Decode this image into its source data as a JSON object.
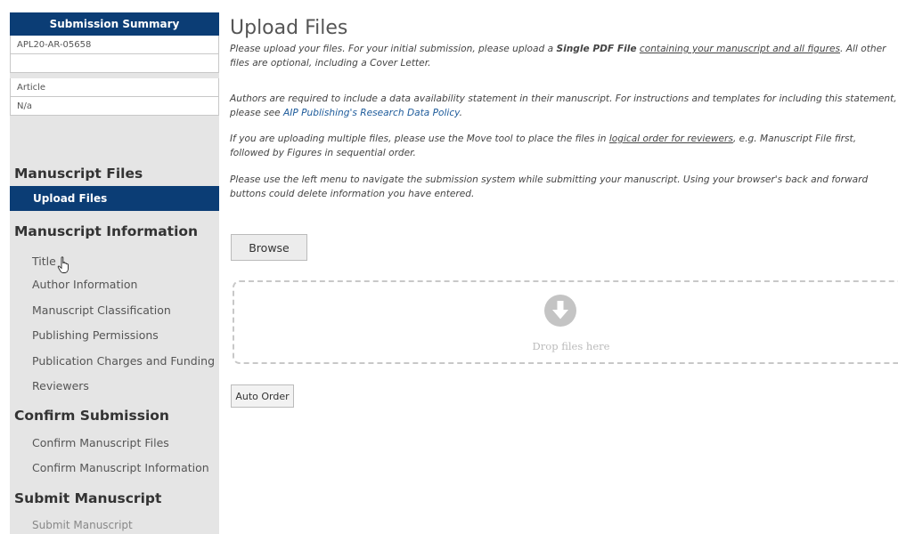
{
  "summary": {
    "heading": "Submission Summary",
    "manuscript_id": "APL20-AR-05658",
    "blank_row": "",
    "article_type": "Article",
    "section": "N/a"
  },
  "nav": {
    "manuscript_files": {
      "heading": "Manuscript Files",
      "items": [
        "Upload Files"
      ]
    },
    "manuscript_information": {
      "heading": "Manuscript Information",
      "items": [
        "Title",
        "Author Information",
        "Manuscript Classification",
        "Publishing Permissions",
        "Publication Charges and Funding",
        "Reviewers"
      ]
    },
    "confirm_submission": {
      "heading": "Confirm Submission",
      "items": [
        "Confirm Manuscript Files",
        "Confirm Manuscript Information"
      ]
    },
    "submit_manuscript": {
      "heading": "Submit Manuscript",
      "items": [
        "Submit Manuscript"
      ]
    }
  },
  "main": {
    "title": "Upload Files",
    "p1": {
      "a": "Please upload your files. For your initial submission, please upload a ",
      "b": "Single PDF File",
      "c": " ",
      "d": "containing your manuscript and all figures",
      "e": ". All other files are optional, including a Cover Letter."
    },
    "p2": {
      "a": "Authors are required to include a data availability statement in their manuscript. For instructions and templates for including this statement, please see ",
      "link": "AIP Publishing's Research Data Policy",
      "b": "."
    },
    "p3": {
      "a": "If you are uploading multiple files, please use the Move tool to place the files in ",
      "u": "logical order for reviewers",
      "b": ", e.g. Manuscript File first, followed by Figures in sequential order."
    },
    "p4": "Please use the left menu to navigate the submission system while submitting your manuscript. Using your browser's back and forward buttons could delete information you have entered.",
    "browse_label": "Browse",
    "drop_label": "Drop files here",
    "auto_order_label": "Auto Order"
  },
  "colors": {
    "nav_active": "#0b3d75",
    "sidebar_bg": "#e5e5e5",
    "link": "#1c5a9a"
  }
}
